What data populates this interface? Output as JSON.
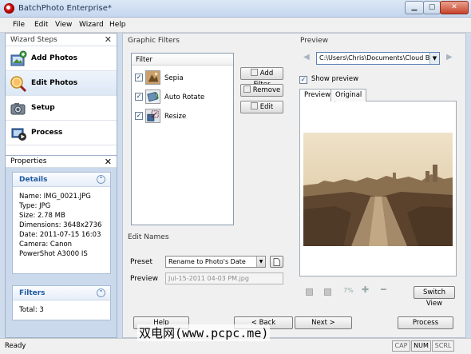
{
  "window": {
    "title": "BatchPhoto Enterprise*",
    "min": "▁",
    "max": "▢",
    "close": "✕"
  },
  "menu": [
    "File",
    "Edit",
    "View",
    "Wizard",
    "Help"
  ],
  "wizard": {
    "header": "Wizard Steps",
    "close": "✕",
    "steps": [
      {
        "label": "Add Photos",
        "icon": "add-photos-icon"
      },
      {
        "label": "Edit Photos",
        "icon": "edit-photos-icon",
        "active": true
      },
      {
        "label": "Setup",
        "icon": "setup-icon"
      },
      {
        "label": "Process",
        "icon": "process-icon"
      }
    ]
  },
  "properties": {
    "header": "Properties",
    "close": "✕",
    "details_title": "Details",
    "details": [
      "Name: IMG_0021.JPG",
      "Type: JPG",
      "Size: 2.78 MB",
      "Dimensions: 3648x2736",
      "Date: 2011-07-15 16:03",
      "Camera: Canon",
      "PowerShot A3000 IS"
    ],
    "filters_title": "Filters",
    "filters_total": "Total: 3",
    "collapse": "⌃"
  },
  "graphic_filters": {
    "label": "Graphic Filters",
    "column": "Filter",
    "items": [
      {
        "name": "Sepia",
        "checked": "✓"
      },
      {
        "name": "Auto Rotate",
        "checked": "✓"
      },
      {
        "name": "Resize",
        "checked": "✓"
      }
    ],
    "add": "Add Filter",
    "remove": "Remove",
    "edit": "Edit"
  },
  "edit_names": {
    "label": "Edit Names",
    "preset_label": "Preset",
    "preset_value": "Rename to Photo's Date",
    "preview_label": "Preview",
    "preview_value": "Jul-15-2011 04-03 PM.jpg"
  },
  "preview": {
    "label": "Preview",
    "path": "C:\\Users\\Chris\\Documents\\Cloud Backu",
    "show_preview": "Show preview",
    "tab_preview": "Preview",
    "tab_original": "Original",
    "zoom": "7%",
    "switch_view": "Switch View"
  },
  "buttons": {
    "help": "Help",
    "back": "< Back",
    "next": "Next >",
    "process": "Process"
  },
  "status": {
    "text": "Ready",
    "cap": "CAP",
    "num": "NUM",
    "scrl": "SCRL"
  },
  "watermark": "双电网(www.pcpc.me)"
}
